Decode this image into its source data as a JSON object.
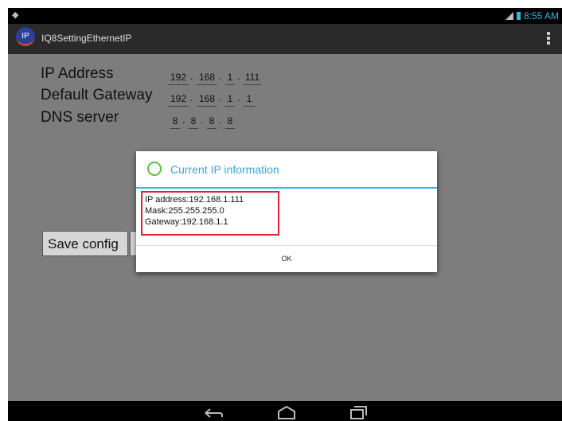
{
  "status_bar": {
    "time": "8:55 AM"
  },
  "action_bar": {
    "app_icon_text": "IP",
    "title": "IQ8SettingEthernetIP"
  },
  "form": {
    "ip_label": "IP Address",
    "gateway_label": "Default Gateway",
    "dns_label": "DNS server",
    "ip": [
      "192",
      "168",
      "1",
      "111"
    ],
    "gateway": [
      "192",
      "168",
      "1",
      "1"
    ],
    "dns": [
      "8",
      "8",
      "8",
      "8"
    ],
    "dot": "."
  },
  "save_button": "Save config",
  "dialog": {
    "title": "Current IP information",
    "lines": [
      "IP address:192.168.1.111",
      "Mask:255.255.255.0",
      "Gateway:192.168.1.1"
    ],
    "ok": "OK"
  },
  "colors": {
    "accent": "#33b5e5",
    "highlight_box": "#e0242e",
    "status_icon": "#55c43c"
  }
}
